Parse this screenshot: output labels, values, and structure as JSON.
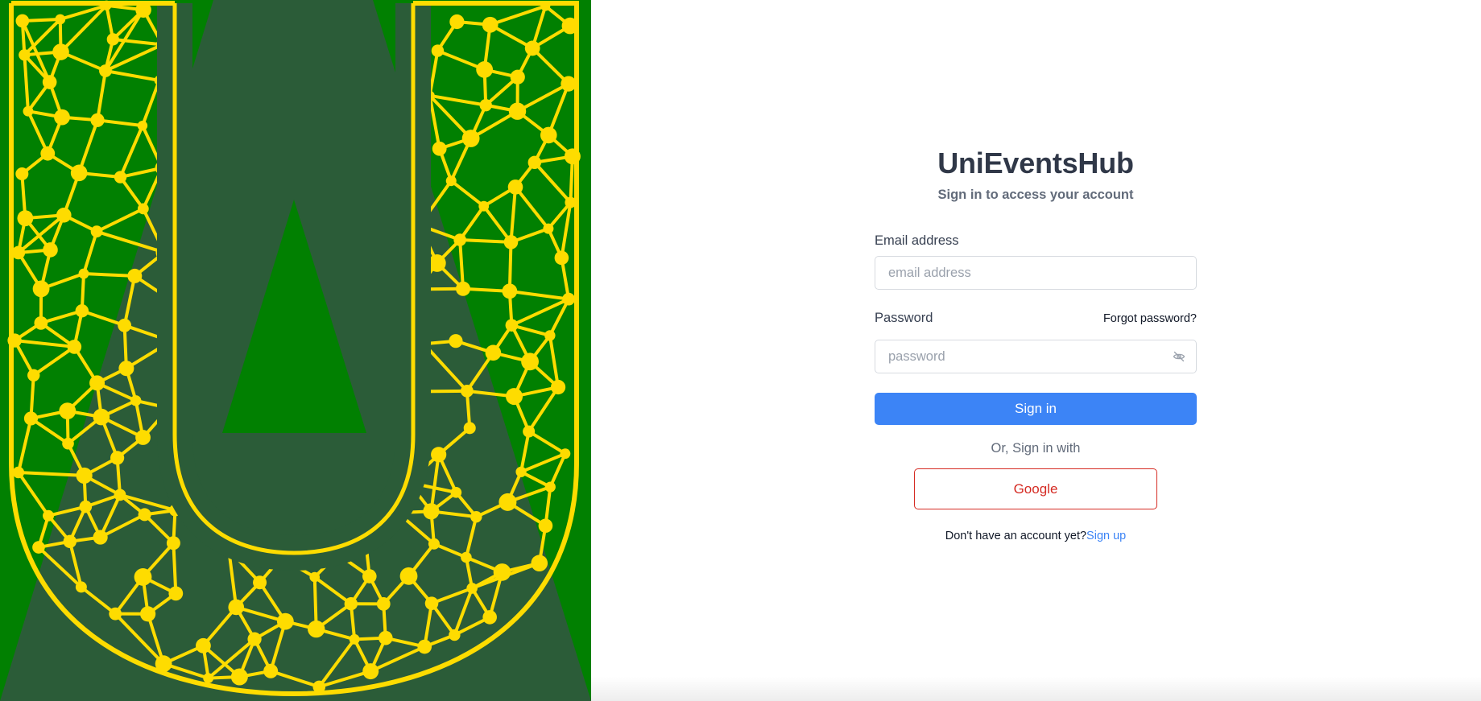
{
  "colors": {
    "hero_background": "#018001",
    "hero_shape": "#2b5c38",
    "hero_network": "#fedc00",
    "primary": "#3c84f6",
    "google": "#d52b23",
    "title": "#303848"
  },
  "hero": {
    "logo_icon": "network-letter-u-logo"
  },
  "login": {
    "title": "UniEventsHub",
    "subtitle": "Sign in to access your account",
    "email_label": "Email address",
    "email_placeholder": "email address",
    "email_value": "",
    "password_label": "Password",
    "forgot_label": "Forgot password?",
    "password_placeholder": "password",
    "password_value": "",
    "visibility_icon": "eye-off-icon",
    "signin_label": "Sign in",
    "or_text": "Or, Sign in with",
    "google_label": "Google",
    "no_account_text": "Don't have an account yet?",
    "signup_label": "Sign up"
  }
}
